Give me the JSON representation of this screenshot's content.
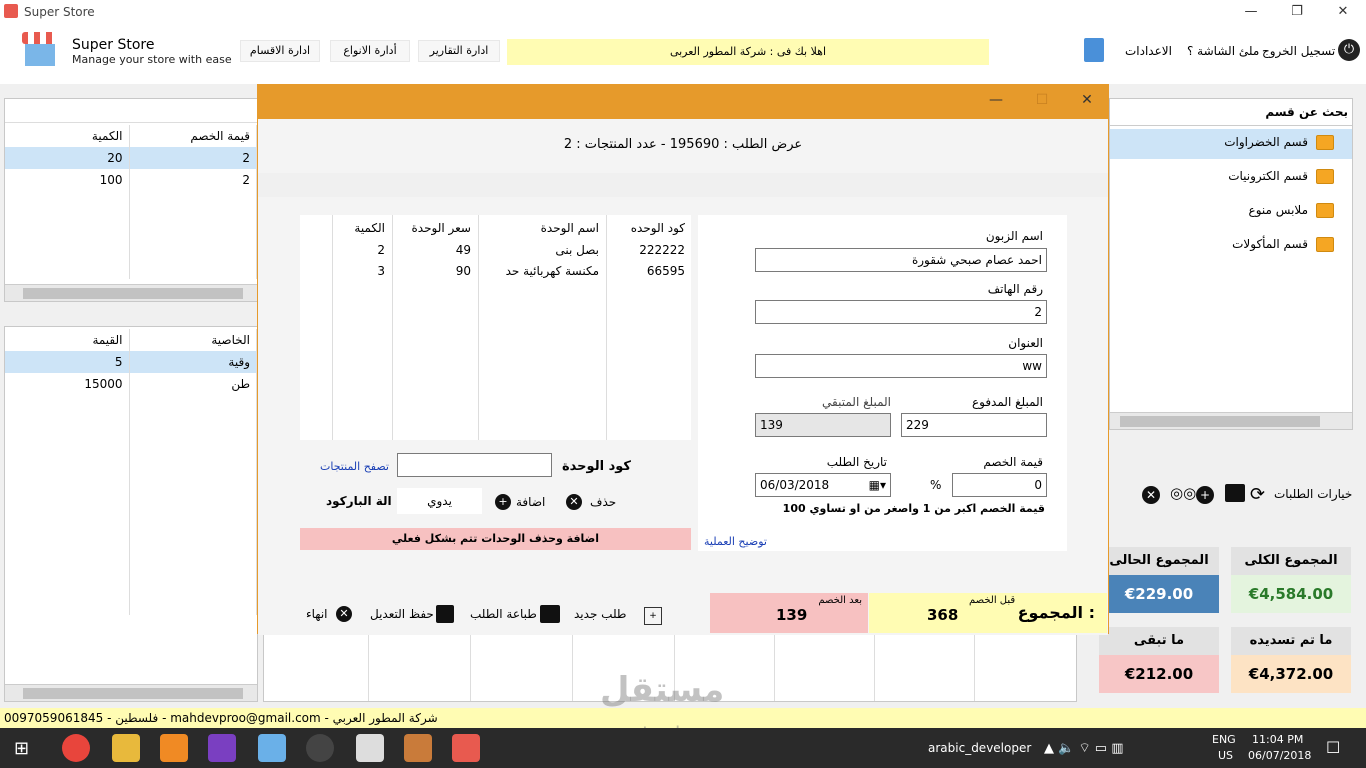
{
  "window": {
    "title": "Super Store",
    "controls": {
      "minimize": "—",
      "maximize": "❐",
      "close": "✕"
    }
  },
  "header": {
    "brand": "Super Store",
    "tagline": "Manage your store with ease",
    "nav": [
      "ادارة الاقسام",
      "أدارة الانواع",
      "ادارة التقارير"
    ],
    "welcome": "اهلا بك فى : شركة المطور العربى",
    "settings": "الاعدادات",
    "fullscreen": "ملئ الشاشة ؟",
    "logout": "تسجيل الخروج"
  },
  "left_top_table": {
    "headers": [
      "قيمة الخصم",
      "الكمية"
    ],
    "rows": [
      [
        "2",
        "20"
      ],
      [
        "2",
        "100"
      ]
    ]
  },
  "left_bottom_table": {
    "headers": [
      "الخاصية",
      "القيمة"
    ],
    "rows": [
      [
        "وقية",
        "5"
      ],
      [
        "طن",
        "15000"
      ]
    ]
  },
  "right_panel": {
    "search_label": "بحث عن قسم",
    "categories": [
      "قسم الخضراوات",
      "قسم الكترونيات",
      "ملابس منوع",
      "قسم المأكولات"
    ],
    "orders_options": "خيارات الطلبات",
    "totals": [
      {
        "title": "المجموع الكلى",
        "value": "€4,584.00",
        "head_bg": "#e2e2e2",
        "val_bg": "#e4f4de",
        "val_color": "#2a7a2a"
      },
      {
        "title": "المجموع الحالى",
        "value": "€229.00",
        "head_bg": "#e2e2e2",
        "val_bg": "#4a83b8",
        "val_color": "#ffffff"
      },
      {
        "title": "ما تم تسديده",
        "value": "€4,372.00",
        "head_bg": "#e2e2e2",
        "val_bg": "#fde3c4",
        "val_color": "#000000"
      },
      {
        "title": "ما تبقى",
        "value": "€212.00",
        "head_bg": "#e2e2e2",
        "val_bg": "#f7c6c6",
        "val_color": "#000000"
      }
    ]
  },
  "modal": {
    "heading": "عرض الطلب : 195690 - عدد المنتجات : 2",
    "controls": {
      "minimize": "—",
      "maximize": "☐",
      "close": "✕"
    },
    "form": {
      "customer_label": "اسم الزبون",
      "customer_value": "احمد عصام صبحي شقورة",
      "phone_label": "رقم الهاتف",
      "phone_value": "2",
      "address_label": "العنوان",
      "address_value": "ww",
      "paid_label": "المبلغ المدفوع",
      "paid_value": "229",
      "remaining_label": "المبلغ المتبقي",
      "remaining_value": "139",
      "discount_label": "قيمة الخصم",
      "discount_value": "0",
      "percent": "%",
      "date_label": "تاريخ الطلب",
      "date_value": "06/03/2018",
      "discount_hint": "قيمة الخصم اكبر من 1 واصغر من او تساوي 100",
      "explain_link": "توضيح العملية"
    },
    "products": {
      "headers": [
        "كود الوحده",
        "اسم الوحدة",
        "سعر الوحدة",
        "الكمية"
      ],
      "rows": [
        [
          "222222",
          "بصل بنى",
          "49",
          "2"
        ],
        [
          "66595",
          "مكنسة كهربائية حد",
          "90",
          "3"
        ]
      ]
    },
    "unit_code_label": "كود الوحدة",
    "browse_link": "تصفح المنتجات",
    "barcode_label": "الة الباركود",
    "barcode_mode": "يدوي",
    "add_label": "اضافة",
    "delete_label": "حذف",
    "warning": "اضافة وحذف الوحدات تتم بشكل فعلي",
    "total_label": "المجموع :",
    "before_label": "قبل الخصم",
    "before_value": "368",
    "after_label": "بعد الخصم",
    "after_value": "139",
    "actions": {
      "new": "طلب جديد",
      "print": "طباعة الطلب",
      "save": "حفظ التعديل",
      "finish": "انهاء"
    }
  },
  "footer": {
    "text": "فلسطين - 0097059061845 - mahdevproo@gmail.com - شركة المطور العربي"
  },
  "watermark": {
    "line1": "مستقل",
    "line2": "mostaql.com"
  },
  "taskbar": {
    "user": "arabic_developer",
    "lang1": "ENG",
    "lang2": "US",
    "time": "11:04 PM",
    "date": "06/07/2018"
  }
}
